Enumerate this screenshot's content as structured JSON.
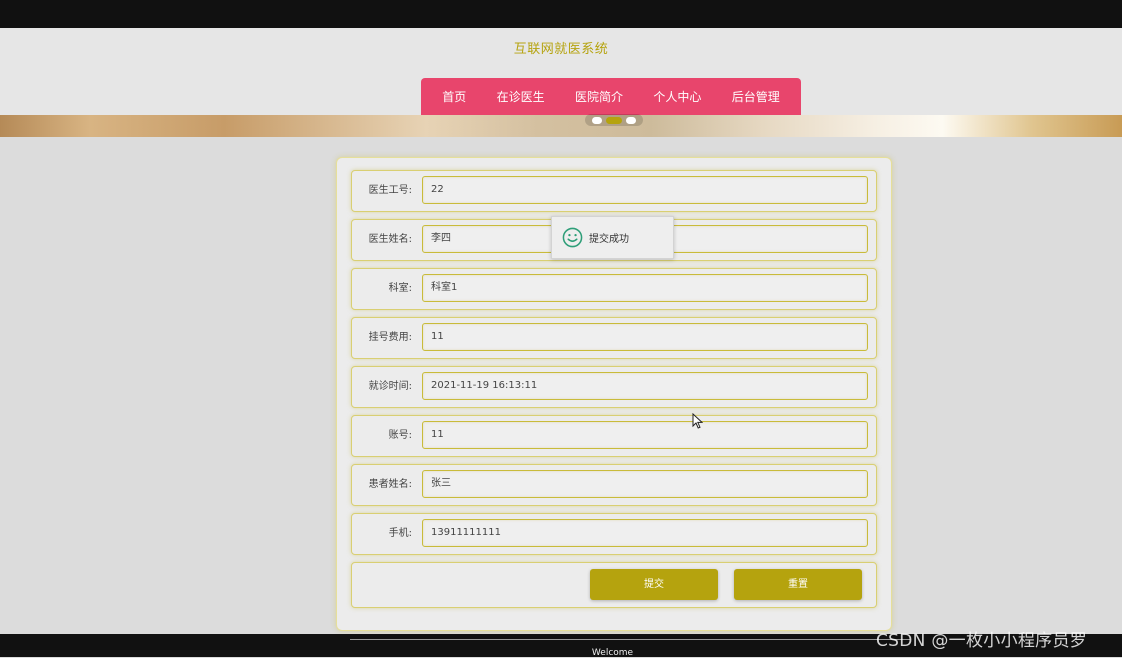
{
  "site": {
    "title": "互联网就医系统"
  },
  "nav": {
    "items": [
      {
        "label": "首页"
      },
      {
        "label": "在诊医生"
      },
      {
        "label": "医院简介"
      },
      {
        "label": "个人中心"
      },
      {
        "label": "后台管理"
      }
    ]
  },
  "carousel": {
    "slide_count": 3,
    "active_index": 1
  },
  "form": {
    "fields": [
      {
        "label": "医生工号:",
        "value": "22"
      },
      {
        "label": "医生姓名:",
        "value": "李四"
      },
      {
        "label": "科室:",
        "value": "科室1"
      },
      {
        "label": "挂号费用:",
        "value": "11"
      },
      {
        "label": "就诊时间:",
        "value": "2021-11-19 16:13:11"
      },
      {
        "label": "账号:",
        "value": "11"
      },
      {
        "label": "患者姓名:",
        "value": "张三"
      },
      {
        "label": "手机:",
        "value": "13911111111"
      }
    ],
    "submit_label": "提交",
    "reset_label": "重置"
  },
  "toast": {
    "message": "提交成功",
    "icon": "smile-icon"
  },
  "footer": {
    "text": "Welcome"
  },
  "watermark": {
    "text": "CSDN @一枚小小程序员罗"
  },
  "colors": {
    "accent": "#b5a30e",
    "nav": "#e8456c",
    "toast_icon": "#2e9e78"
  }
}
